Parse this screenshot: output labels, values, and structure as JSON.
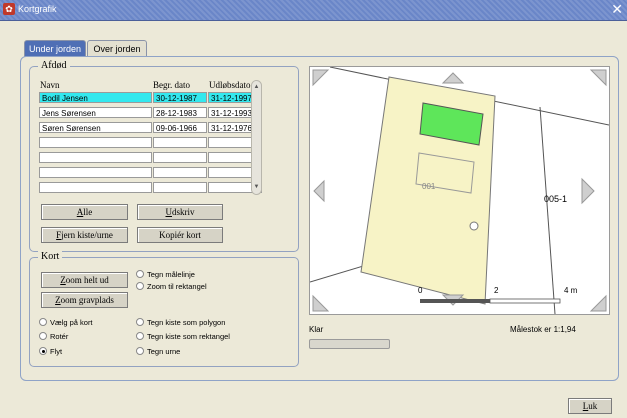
{
  "window": {
    "title": "Kortgrafik",
    "close_label": "✕"
  },
  "tabs": [
    {
      "label": "Under jorden",
      "active": true
    },
    {
      "label": "Over jorden",
      "active": false
    }
  ],
  "afdod": {
    "legend": "Afdød",
    "headers": {
      "name": "Navn",
      "begr": "Begr. dato",
      "udl": "Udløbsdato"
    },
    "rows": [
      {
        "name": "Bodil Jensen",
        "begr": "30-12-1987",
        "udl": "31-12-1997",
        "selected": true
      },
      {
        "name": "Jens Sørensen",
        "begr": "28-12-1983",
        "udl": "31-12-1993",
        "selected": false
      },
      {
        "name": "Søren Sørensen",
        "begr": "09-06-1966",
        "udl": "31-12-1976",
        "selected": false
      },
      {
        "name": "",
        "begr": "",
        "udl": ""
      },
      {
        "name": "",
        "begr": "",
        "udl": ""
      },
      {
        "name": "",
        "begr": "",
        "udl": ""
      },
      {
        "name": "",
        "begr": "",
        "udl": ""
      }
    ],
    "buttons": {
      "alle_mn": "A",
      "alle_rest": "lle",
      "udskriv_mn": "U",
      "udskriv_rest": "dskriv",
      "fjern_mn": "F",
      "fjern_rest": "jern kiste/urne",
      "kopier": "Kopiér kort"
    }
  },
  "kort": {
    "legend": "Kort",
    "buttons": {
      "zoom_helt_mn": "Z",
      "zoom_helt_rest": "oom helt ud",
      "zoom_grav_mn": "Z",
      "zoom_grav_rest": "oom gravplads"
    },
    "options": {
      "tegn_malelinje": "Tegn målelinje",
      "zoom_rektangel": "Zoom til rektangel",
      "vaelg_pa_kort": "Vælg på kort",
      "roter": "Rotér",
      "flyt": "Flyt",
      "kiste_polygon": "Tegn kiste som polygon",
      "kiste_rektangel": "Tegn kiste som rektangel",
      "urne": "Tegn urne"
    },
    "selected_option": "Flyt"
  },
  "map": {
    "grave_label": "001",
    "plot_label": "005-1",
    "scale_ticks": [
      "0",
      "2",
      "4 m"
    ]
  },
  "status": {
    "text": "Klar",
    "scale": "Målestok er 1:1,94"
  },
  "footer": {
    "luk_mn": "L",
    "luk_rest": "uk"
  },
  "colors": {
    "selected_row": "#33e8ee",
    "tab_active": "#4f6fb5",
    "grave_fill": "#f7f3c6",
    "headstone": "#5ee65a",
    "titlebar": "#6a86c8"
  }
}
